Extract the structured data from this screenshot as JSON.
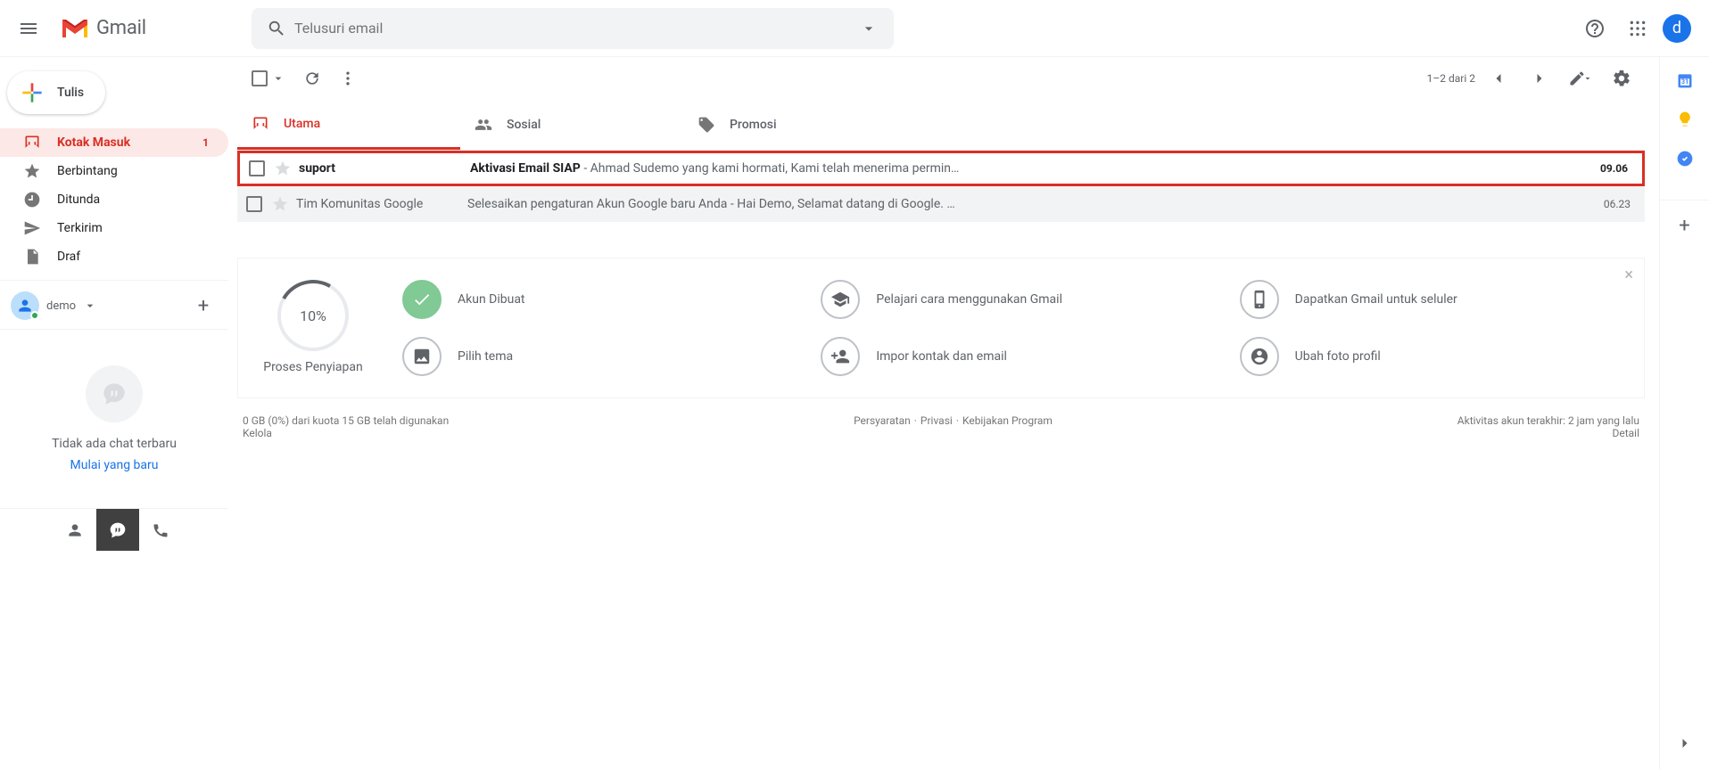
{
  "header": {
    "brand": "Gmail",
    "search_placeholder": "Telusuri email",
    "avatar_letter": "d"
  },
  "compose_label": "Tulis",
  "nav": [
    {
      "label": "Kotak Masuk",
      "count": "1",
      "active": true,
      "icon": "inbox"
    },
    {
      "label": "Berbintang",
      "icon": "star"
    },
    {
      "label": "Ditunda",
      "icon": "clock"
    },
    {
      "label": "Terkirim",
      "icon": "send"
    },
    {
      "label": "Draf",
      "icon": "draft"
    }
  ],
  "hangouts": {
    "name": "demo",
    "empty": "Tidak ada chat terbaru",
    "start": "Mulai yang baru"
  },
  "toolbar": {
    "range": "1–2 dari 2"
  },
  "tabs": [
    {
      "label": "Utama",
      "icon": "inbox",
      "active": true
    },
    {
      "label": "Sosial",
      "icon": "people"
    },
    {
      "label": "Promosi",
      "icon": "tag"
    }
  ],
  "rows": [
    {
      "sender": "suport",
      "subject": "Aktivasi Email SIAP",
      "snippet": " - Ahmad Sudemo yang kami hormati, Kami telah menerima permin…",
      "time": "09.06",
      "unread": true,
      "highlight": true
    },
    {
      "sender": "Tim Komunitas Google",
      "subject": "Selesaikan pengaturan Akun Google baru Anda",
      "snippet": " - Hai Demo, Selamat datang di Google. …",
      "time": "06.23",
      "unread": false
    }
  ],
  "setup": {
    "percent": "10%",
    "label": "Proses Penyiapan",
    "items": [
      {
        "label": "Akun Dibuat",
        "icon": "check",
        "done": true
      },
      {
        "label": "Pelajari cara menggunakan Gmail",
        "icon": "school"
      },
      {
        "label": "Dapatkan Gmail untuk seluler",
        "icon": "phone"
      },
      {
        "label": "Pilih tema",
        "icon": "image"
      },
      {
        "label": "Impor kontak dan email",
        "icon": "personadd"
      },
      {
        "label": "Ubah foto profil",
        "icon": "account"
      }
    ]
  },
  "footer": {
    "storage_line": "0 GB (0%) dari kuota 15 GB telah digunakan",
    "manage": "Kelola",
    "terms": "Persyaratan",
    "privacy": "Privasi",
    "program": "Kebijakan Program",
    "activity": "Aktivitas akun terakhir: 2 jam yang lalu",
    "detail": "Detail"
  }
}
